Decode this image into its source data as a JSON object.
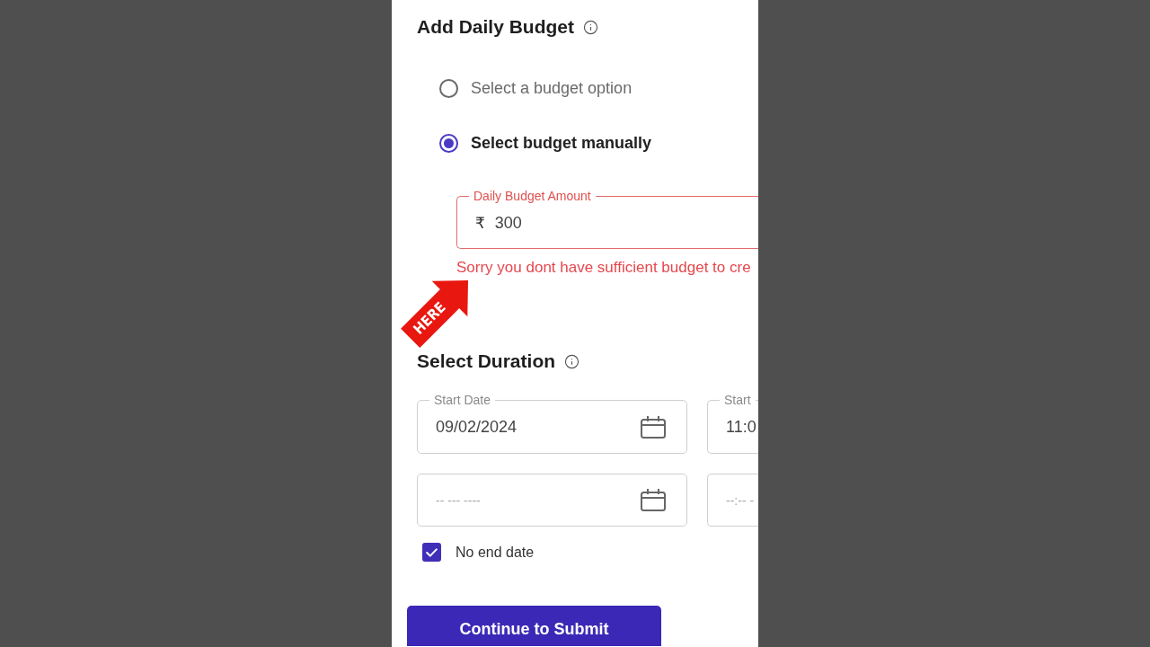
{
  "budget_section": {
    "title": "Add Daily Budget",
    "options": [
      {
        "label": "Select a budget option",
        "selected": false
      },
      {
        "label": "Select budget manually",
        "selected": true
      }
    ],
    "amount_field": {
      "label": "Daily Budget Amount",
      "currency_symbol": "₹",
      "value": "300",
      "error": true,
      "error_message": "Sorry you dont have sufficient budget to cre"
    }
  },
  "annotation": {
    "label": "HERE"
  },
  "duration_section": {
    "title": "Select Duration",
    "fields": [
      {
        "kind": "date",
        "label": "Start Date",
        "value": "09/02/2024"
      },
      {
        "kind": "time",
        "label": "Start",
        "value": "11:0"
      },
      {
        "kind": "date",
        "placeholder": "-- --- ----"
      },
      {
        "kind": "time",
        "placeholder": "--:-- -"
      }
    ],
    "no_end_date": {
      "label": "No end date",
      "checked": true
    }
  },
  "submit_button": {
    "label": "Continue to Submit"
  }
}
